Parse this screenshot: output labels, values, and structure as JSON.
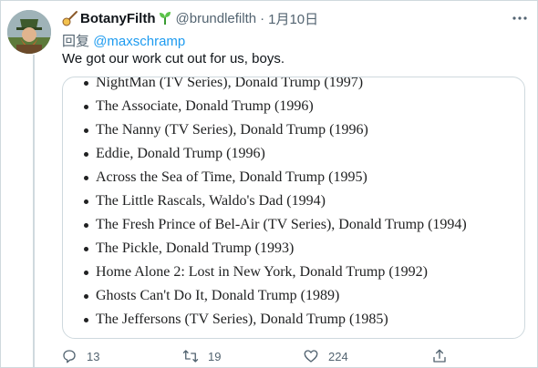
{
  "tweet": {
    "display_name": "BotanyFilth",
    "handle": "@brundlefilth",
    "separator": "·",
    "date": "1月10日",
    "reply_prefix": "回复",
    "reply_to": "@maxschramp",
    "text": "We got our work cut out for us, boys."
  },
  "credits": [
    "NightMan (TV Series), Donald Trump (1997)",
    "The Associate, Donald Trump (1996)",
    "The Nanny (TV Series), Donald Trump (1996)",
    "Eddie, Donald Trump (1996)",
    "Across the Sea of Time, Donald Trump (1995)",
    "The Little Rascals, Waldo's Dad (1994)",
    "The Fresh Prince of Bel-Air (TV Series), Donald Trump (1994)",
    "The Pickle, Donald Trump (1993)",
    "Home Alone 2: Lost in New York, Donald Trump (1992)",
    "Ghosts Can't Do It, Donald Trump (1989)",
    "The Jeffersons (TV Series), Donald Trump (1985)"
  ],
  "actions": {
    "reply_count": "13",
    "retweet_count": "19",
    "like_count": "224"
  },
  "icons": {
    "more": "more-icon",
    "reply": "reply-icon",
    "retweet": "retweet-icon",
    "like": "heart-icon",
    "share": "share-icon",
    "banjo": "banjo-emoji-icon",
    "sprout": "sprout-emoji-icon"
  },
  "colors": {
    "accent": "#1d9bf0",
    "secondary_text": "#536471",
    "border": "#cfd9de"
  }
}
